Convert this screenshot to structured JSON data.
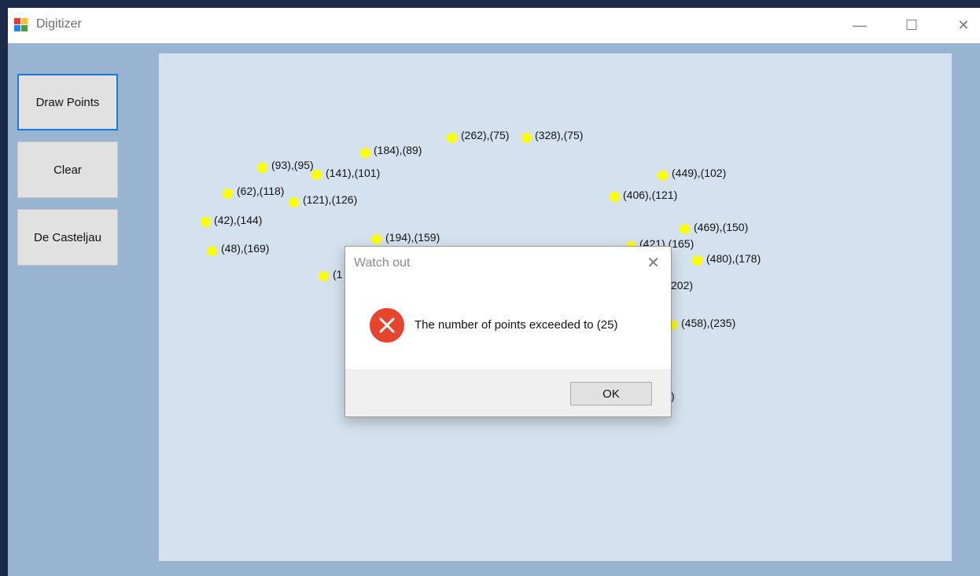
{
  "window": {
    "title": "Digitizer",
    "minimize_glyph": "—",
    "maximize_glyph": "☐",
    "close_glyph": "✕"
  },
  "sidebar": {
    "buttons": [
      {
        "label": "Draw Points",
        "active": true
      },
      {
        "label": "Clear",
        "active": false
      },
      {
        "label": "De Casteljau",
        "active": false
      }
    ]
  },
  "canvas": {
    "point_color": "#ffff00",
    "points": [
      {
        "label": "(93),(95)"
      },
      {
        "label": "(184),(89)"
      },
      {
        "label": "(262),(75)"
      },
      {
        "label": "(328),(75)"
      },
      {
        "label": "(141),(101)"
      },
      {
        "label": "(62),(118)"
      },
      {
        "label": "(121),(126)"
      },
      {
        "label": "(42),(144)"
      },
      {
        "label": "(48),(169)"
      },
      {
        "label": "(194),(159)"
      },
      {
        "label": "(1"
      },
      {
        "label": "(449),(102)"
      },
      {
        "label": "(406),(121)"
      },
      {
        "label": "(469),(150)"
      },
      {
        "label": "(421),(165)"
      },
      {
        "label": "(480),(178)"
      },
      {
        "label": "202)"
      },
      {
        "label": "(458),(235)"
      },
      {
        "label": ")"
      }
    ]
  },
  "dialog": {
    "title": "Watch out",
    "close_glyph": "✕",
    "message": "The number of points exceeded to (25)",
    "ok_label": "OK",
    "icon": "error-icon",
    "icon_color": "#e8432c"
  }
}
